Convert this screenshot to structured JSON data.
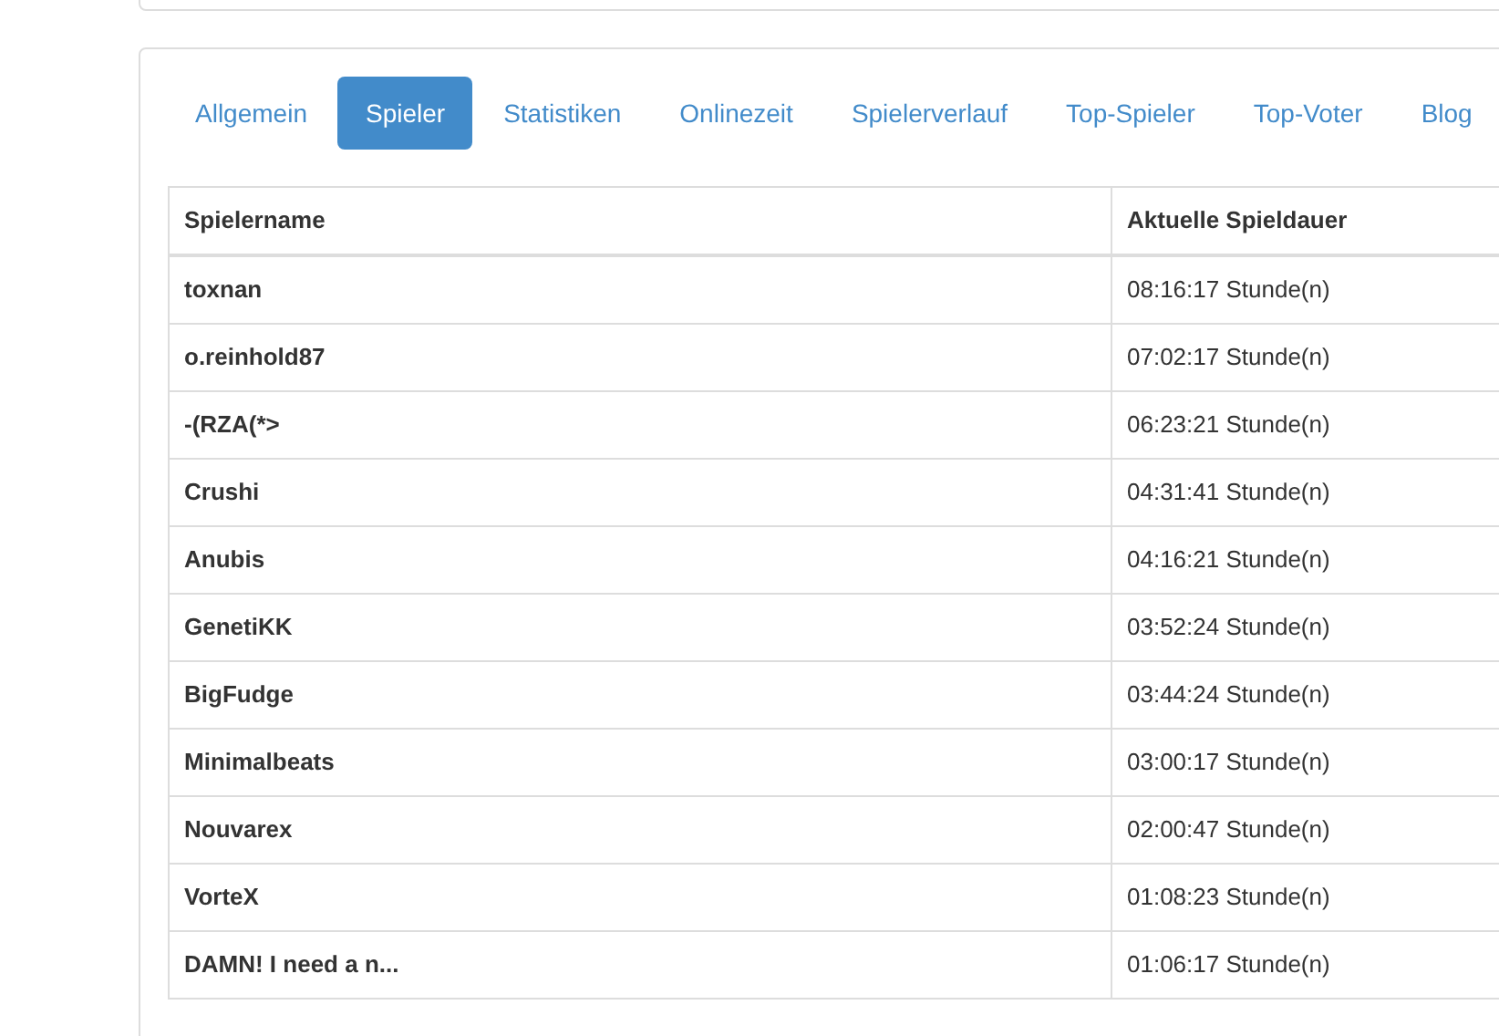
{
  "tabs": [
    {
      "label": "Allgemein",
      "selected": false
    },
    {
      "label": "Spieler",
      "selected": true
    },
    {
      "label": "Statistiken",
      "selected": false
    },
    {
      "label": "Onlinezeit",
      "selected": false
    },
    {
      "label": "Spielerverlauf",
      "selected": false
    },
    {
      "label": "Top-Spieler",
      "selected": false
    },
    {
      "label": "Top-Voter",
      "selected": false
    },
    {
      "label": "Blog",
      "selected": false
    }
  ],
  "table": {
    "columns": [
      "Spielername",
      "Aktuelle Spieldauer"
    ],
    "rows": [
      [
        "toxnan",
        "08:16:17 Stunde(n)"
      ],
      [
        "o.reinhold87",
        "07:02:17 Stunde(n)"
      ],
      [
        "-(RZA(*>",
        "06:23:21 Stunde(n)"
      ],
      [
        "Crushi",
        "04:31:41 Stunde(n)"
      ],
      [
        "Anubis",
        "04:16:21 Stunde(n)"
      ],
      [
        "GenetiKK",
        "03:52:24 Stunde(n)"
      ],
      [
        "BigFudge",
        "03:44:24 Stunde(n)"
      ],
      [
        "Minimalbeats",
        "03:00:17 Stunde(n)"
      ],
      [
        "Nouvarex",
        "02:00:47 Stunde(n)"
      ],
      [
        "VorteX",
        "01:08:23 Stunde(n)"
      ],
      [
        "DAMN! I need a n...",
        "01:06:17 Stunde(n)"
      ]
    ]
  }
}
